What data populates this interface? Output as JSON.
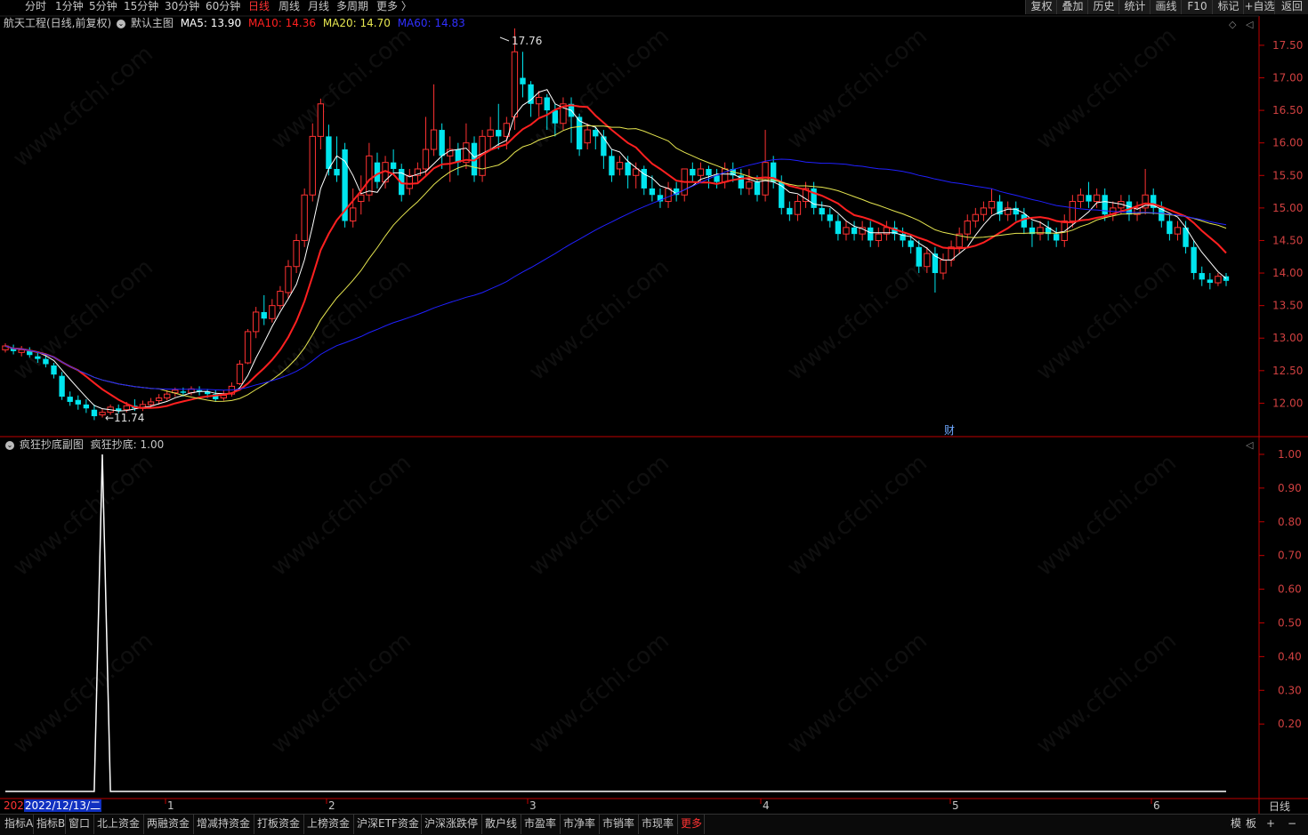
{
  "topbar": {
    "periods": [
      "分时",
      "1分钟",
      "5分钟",
      "15分钟",
      "30分钟",
      "60分钟",
      "日线",
      "周线",
      "月线",
      "多周期",
      "更多 〉"
    ],
    "active": "日线",
    "right_buttons": [
      "复权",
      "叠加",
      "历史",
      "统计",
      "画线",
      "F10",
      "标记",
      "+自选",
      "返回"
    ]
  },
  "main_chart": {
    "stock_title": "航天工程(日线,前复权)",
    "template": "默认主图",
    "ma5_label": "MA5: 13.90",
    "ma10_label": "MA10: 14.36",
    "ma20_label": "MA20: 14.70",
    "ma60_label": "MA60: 14.83",
    "high_mark": "17.76",
    "low_mark": "←11.74",
    "finance_marker": "财"
  },
  "sub_chart": {
    "title": "疯狂抄底副图",
    "value_label": "疯狂抄底: 1.00"
  },
  "colors": {
    "up": "#ff3232",
    "down": "#00e5ee",
    "ma5": "#ffffff",
    "ma10": "#ff2020",
    "ma20": "#e6e650",
    "ma60": "#2020ff",
    "axis": "#c00000"
  },
  "date_axis": {
    "cursor_date_prefix": "202",
    "cursor_date": "2022/12/13/二",
    "months": [
      "1",
      "2",
      "3",
      "4",
      "5",
      "6"
    ],
    "right_label": "日线"
  },
  "bottombar": {
    "items": [
      "指标A",
      "指标B",
      "窗口",
      "北上资金",
      "两融资金",
      "增减持资金",
      "打板资金",
      "上榜资金",
      "沪深ETF资金",
      "沪深涨跌停",
      "散户线",
      "市盈率",
      "市净率",
      "市销率",
      "市现率",
      "更多"
    ],
    "right_items": [
      "模",
      "板",
      "+",
      "−"
    ]
  },
  "watermark": "www.cfchi.com",
  "chart_data": [
    {
      "type": "candlestick",
      "title": "航天工程(日线,前复权)",
      "ylim": [
        11.5,
        17.95
      ],
      "yticks": [
        12.0,
        12.5,
        13.0,
        13.5,
        14.0,
        14.5,
        15.0,
        15.5,
        16.0,
        16.5,
        17.0,
        17.5
      ],
      "series": [
        {
          "name": "MA5"
        },
        {
          "name": "MA10"
        },
        {
          "name": "MA20"
        },
        {
          "name": "MA60"
        }
      ],
      "max_label": 17.76,
      "min_label": 11.74,
      "candles": [
        [
          12.82,
          12.88,
          12.92,
          12.78
        ],
        [
          12.85,
          12.8,
          12.9,
          12.75
        ],
        [
          12.78,
          12.82,
          12.88,
          12.72
        ],
        [
          12.8,
          12.74,
          12.86,
          12.7
        ],
        [
          12.72,
          12.68,
          12.78,
          12.62
        ],
        [
          12.68,
          12.6,
          12.74,
          12.55
        ],
        [
          12.58,
          12.44,
          12.62,
          12.38
        ],
        [
          12.42,
          12.1,
          12.48,
          12.05
        ],
        [
          12.1,
          12.02,
          12.18,
          11.96
        ],
        [
          12.05,
          11.98,
          12.12,
          11.9
        ],
        [
          11.98,
          11.92,
          12.06,
          11.85
        ],
        [
          11.9,
          11.8,
          11.98,
          11.74
        ],
        [
          11.82,
          11.86,
          11.92,
          11.78
        ],
        [
          11.86,
          11.94,
          11.98,
          11.82
        ],
        [
          11.92,
          11.88,
          11.98,
          11.84
        ],
        [
          11.9,
          11.96,
          12.02,
          11.86
        ],
        [
          11.96,
          11.92,
          12.06,
          11.88
        ],
        [
          11.92,
          11.98,
          12.04,
          11.88
        ],
        [
          11.98,
          12.02,
          12.08,
          11.92
        ],
        [
          12.04,
          12.08,
          12.14,
          11.98
        ],
        [
          12.08,
          12.14,
          12.2,
          12.04
        ],
        [
          12.16,
          12.2,
          12.24,
          12.1
        ],
        [
          12.18,
          12.16,
          12.24,
          12.1
        ],
        [
          12.16,
          12.22,
          12.26,
          12.12
        ],
        [
          12.2,
          12.18,
          12.26,
          12.12
        ],
        [
          12.18,
          12.14,
          12.22,
          12.08
        ],
        [
          12.14,
          12.06,
          12.2,
          12.02
        ],
        [
          12.08,
          12.12,
          12.2,
          12.04
        ],
        [
          12.14,
          12.26,
          12.32,
          12.1
        ],
        [
          12.3,
          12.6,
          12.66,
          12.28
        ],
        [
          12.62,
          13.1,
          13.14,
          12.6
        ],
        [
          13.1,
          13.4,
          13.48,
          13.0
        ],
        [
          13.4,
          13.3,
          13.66,
          13.2
        ],
        [
          13.3,
          13.5,
          13.6,
          13.24
        ],
        [
          13.5,
          13.72,
          13.8,
          13.44
        ],
        [
          13.7,
          14.1,
          14.2,
          13.6
        ],
        [
          14.1,
          14.5,
          14.6,
          14.0
        ],
        [
          14.5,
          15.2,
          15.3,
          14.4
        ],
        [
          15.2,
          16.1,
          16.3,
          15.1
        ],
        [
          16.1,
          16.6,
          16.68,
          15.9
        ],
        [
          16.1,
          15.6,
          16.28,
          15.5
        ],
        [
          15.6,
          15.5,
          16.1,
          15.4
        ],
        [
          15.9,
          14.8,
          16.0,
          14.7
        ],
        [
          14.8,
          15.0,
          15.3,
          14.7
        ],
        [
          15.1,
          15.2,
          15.5,
          14.9
        ],
        [
          15.2,
          15.8,
          16.0,
          15.1
        ],
        [
          15.7,
          15.4,
          15.85,
          15.3
        ],
        [
          15.4,
          15.7,
          15.8,
          15.3
        ],
        [
          15.7,
          15.6,
          15.9,
          15.5
        ],
        [
          15.6,
          15.2,
          15.68,
          15.1
        ],
        [
          15.3,
          15.5,
          15.6,
          15.2
        ],
        [
          15.5,
          15.6,
          15.7,
          15.4
        ],
        [
          15.6,
          15.9,
          16.4,
          15.5
        ],
        [
          15.9,
          16.2,
          16.9,
          15.8
        ],
        [
          16.2,
          15.8,
          16.3,
          15.6
        ],
        [
          15.8,
          15.9,
          16.1,
          15.4
        ],
        [
          15.9,
          15.7,
          16.0,
          15.5
        ],
        [
          15.7,
          16.0,
          16.3,
          15.6
        ],
        [
          16.0,
          15.5,
          16.1,
          15.4
        ],
        [
          15.5,
          16.1,
          16.2,
          15.4
        ],
        [
          16.1,
          16.2,
          16.4,
          15.9
        ],
        [
          16.2,
          16.1,
          16.6,
          15.9
        ],
        [
          16.1,
          16.3,
          16.4,
          15.9
        ],
        [
          16.4,
          17.4,
          17.76,
          16.2
        ],
        [
          17.0,
          16.9,
          17.4,
          16.7
        ],
        [
          16.9,
          16.6,
          16.95,
          16.4
        ],
        [
          16.6,
          16.7,
          16.8,
          16.4
        ],
        [
          16.7,
          16.5,
          16.75,
          16.2
        ],
        [
          16.5,
          16.3,
          16.6,
          16.1
        ],
        [
          16.3,
          16.6,
          16.7,
          16.2
        ],
        [
          16.6,
          16.4,
          16.7,
          16.0
        ],
        [
          16.4,
          15.9,
          16.45,
          15.8
        ],
        [
          16.0,
          16.2,
          16.3,
          15.9
        ],
        [
          16.2,
          16.1,
          16.25,
          15.9
        ],
        [
          16.1,
          15.8,
          16.2,
          15.6
        ],
        [
          15.8,
          15.5,
          15.9,
          15.4
        ],
        [
          15.6,
          15.7,
          15.8,
          15.5
        ],
        [
          15.7,
          15.5,
          15.8,
          15.3
        ],
        [
          15.5,
          15.6,
          15.7,
          15.3
        ],
        [
          15.6,
          15.3,
          15.65,
          15.2
        ],
        [
          15.3,
          15.2,
          15.5,
          15.1
        ],
        [
          15.2,
          15.1,
          15.3,
          15.0
        ],
        [
          15.1,
          15.3,
          15.4,
          15.0
        ],
        [
          15.3,
          15.2,
          15.4,
          15.1
        ],
        [
          15.2,
          15.6,
          15.6,
          15.1
        ],
        [
          15.6,
          15.5,
          15.7,
          15.4
        ],
        [
          15.5,
          15.6,
          15.7,
          15.4
        ],
        [
          15.6,
          15.5,
          15.65,
          15.3
        ],
        [
          15.5,
          15.4,
          15.6,
          15.3
        ],
        [
          15.4,
          15.6,
          15.7,
          15.3
        ],
        [
          15.6,
          15.5,
          15.7,
          15.4
        ],
        [
          15.5,
          15.3,
          15.6,
          15.2
        ],
        [
          15.3,
          15.4,
          15.6,
          15.2
        ],
        [
          15.4,
          15.2,
          15.5,
          15.1
        ],
        [
          15.2,
          15.7,
          16.2,
          15.1
        ],
        [
          15.7,
          15.4,
          15.8,
          15.3
        ],
        [
          15.4,
          15.0,
          15.5,
          14.9
        ],
        [
          15.0,
          14.9,
          15.1,
          14.8
        ],
        [
          14.9,
          15.1,
          15.2,
          14.8
        ],
        [
          15.1,
          15.3,
          15.4,
          15.0
        ],
        [
          15.3,
          15.0,
          15.4,
          14.9
        ],
        [
          15.0,
          14.9,
          15.1,
          14.8
        ],
        [
          14.9,
          14.8,
          15.0,
          14.7
        ],
        [
          14.8,
          14.6,
          14.9,
          14.5
        ],
        [
          14.6,
          14.7,
          14.8,
          14.5
        ],
        [
          14.7,
          14.6,
          14.8,
          14.5
        ],
        [
          14.6,
          14.7,
          14.8,
          14.5
        ],
        [
          14.7,
          14.5,
          14.8,
          14.4
        ],
        [
          14.5,
          14.6,
          14.7,
          14.4
        ],
        [
          14.6,
          14.7,
          14.8,
          14.5
        ],
        [
          14.7,
          14.6,
          14.8,
          14.5
        ],
        [
          14.6,
          14.5,
          14.7,
          14.4
        ],
        [
          14.5,
          14.4,
          14.6,
          14.3
        ],
        [
          14.4,
          14.1,
          14.5,
          14.0
        ],
        [
          14.1,
          14.3,
          14.4,
          14.0
        ],
        [
          14.3,
          14.0,
          14.4,
          13.7
        ],
        [
          14.0,
          14.2,
          14.3,
          13.9
        ],
        [
          14.2,
          14.4,
          14.5,
          14.1
        ],
        [
          14.4,
          14.6,
          14.7,
          14.3
        ],
        [
          14.6,
          14.8,
          14.9,
          14.5
        ],
        [
          14.8,
          14.9,
          15.0,
          14.7
        ],
        [
          14.9,
          15.0,
          15.1,
          14.8
        ],
        [
          15.0,
          15.1,
          15.3,
          14.9
        ],
        [
          15.1,
          14.9,
          15.2,
          14.8
        ],
        [
          14.9,
          15.0,
          15.1,
          14.8
        ],
        [
          15.0,
          14.9,
          15.1,
          14.8
        ],
        [
          14.9,
          14.7,
          15.0,
          14.6
        ],
        [
          14.7,
          14.6,
          14.8,
          14.4
        ],
        [
          14.6,
          14.7,
          14.8,
          14.5
        ],
        [
          14.7,
          14.6,
          14.8,
          14.5
        ],
        [
          14.6,
          14.5,
          14.7,
          14.4
        ],
        [
          14.5,
          14.8,
          14.9,
          14.4
        ],
        [
          14.8,
          15.1,
          15.2,
          14.7
        ],
        [
          15.1,
          15.2,
          15.3,
          15.0
        ],
        [
          15.2,
          15.1,
          15.4,
          15.0
        ],
        [
          15.1,
          15.2,
          15.3,
          15.0
        ],
        [
          15.2,
          14.9,
          15.3,
          14.8
        ],
        [
          14.9,
          15.0,
          15.1,
          14.8
        ],
        [
          15.0,
          15.1,
          15.2,
          14.9
        ],
        [
          15.1,
          14.9,
          15.2,
          14.8
        ],
        [
          14.9,
          15.0,
          15.1,
          14.8
        ],
        [
          15.0,
          15.2,
          15.6,
          14.9
        ],
        [
          15.2,
          15.0,
          15.3,
          14.9
        ],
        [
          15.0,
          14.8,
          15.1,
          14.7
        ],
        [
          14.8,
          14.6,
          14.9,
          14.5
        ],
        [
          14.6,
          14.7,
          14.8,
          14.5
        ],
        [
          14.7,
          14.4,
          14.8,
          14.3
        ],
        [
          14.4,
          14.0,
          14.5,
          13.9
        ],
        [
          14.0,
          13.9,
          14.1,
          13.8
        ],
        [
          13.9,
          13.85,
          14.0,
          13.75
        ],
        [
          13.85,
          13.95,
          14.0,
          13.8
        ],
        [
          13.95,
          13.88,
          14.0,
          13.8
        ]
      ]
    },
    {
      "type": "line",
      "title": "疯狂抄底副图",
      "ylim": [
        0,
        1.05
      ],
      "yticks": [
        0.2,
        0.3,
        0.4,
        0.5,
        0.6,
        0.7,
        0.8,
        0.9,
        1.0
      ],
      "series": [
        {
          "name": "疯狂抄底",
          "signal_days": [
            12,
            153
          ]
        }
      ]
    }
  ]
}
